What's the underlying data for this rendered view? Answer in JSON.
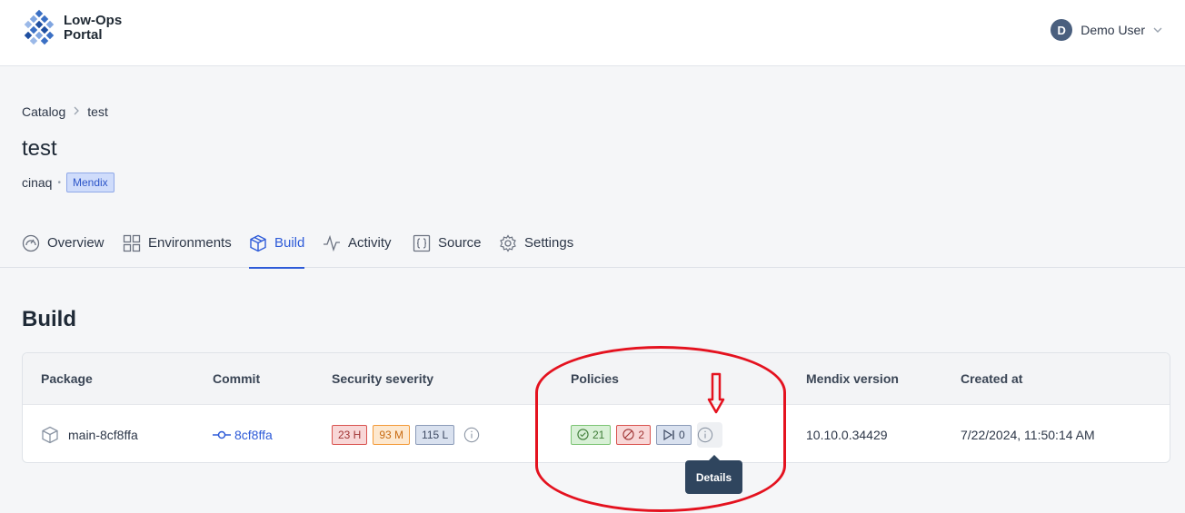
{
  "header": {
    "app_name_line1": "Low-Ops",
    "app_name_line2": "Portal",
    "user_initial": "D",
    "user_name": "Demo User"
  },
  "breadcrumb": {
    "root": "Catalog",
    "current": "test"
  },
  "page": {
    "title": "test",
    "owner": "cinaq",
    "tag": "Mendix"
  },
  "tabs": [
    {
      "label": "Overview",
      "icon": "gauge-icon"
    },
    {
      "label": "Environments",
      "icon": "grid-icon"
    },
    {
      "label": "Build",
      "icon": "box-icon",
      "active": true
    },
    {
      "label": "Activity",
      "icon": "activity-icon"
    },
    {
      "label": "Source",
      "icon": "braces-icon"
    },
    {
      "label": "Settings",
      "icon": "gear-icon"
    }
  ],
  "build": {
    "title": "Build",
    "columns": [
      "Package",
      "Commit",
      "Security severity",
      "Policies",
      "Mendix version",
      "Created at"
    ],
    "rows": [
      {
        "package": "main-8cf8ffa",
        "commit": "8cf8ffa",
        "severity": {
          "high": "23 H",
          "medium": "93 M",
          "low": "115 L"
        },
        "policies": {
          "passed": "21",
          "failed": "2",
          "skipped": "0"
        },
        "mendix_version": "10.10.0.34429",
        "created_at": "7/22/2024, 11:50:14 AM"
      }
    ]
  },
  "tooltip": {
    "text": "Details"
  },
  "colors": {
    "accent": "#2e5bd8",
    "annotation": "#e4121f",
    "tooltip_bg": "#2f455e"
  }
}
